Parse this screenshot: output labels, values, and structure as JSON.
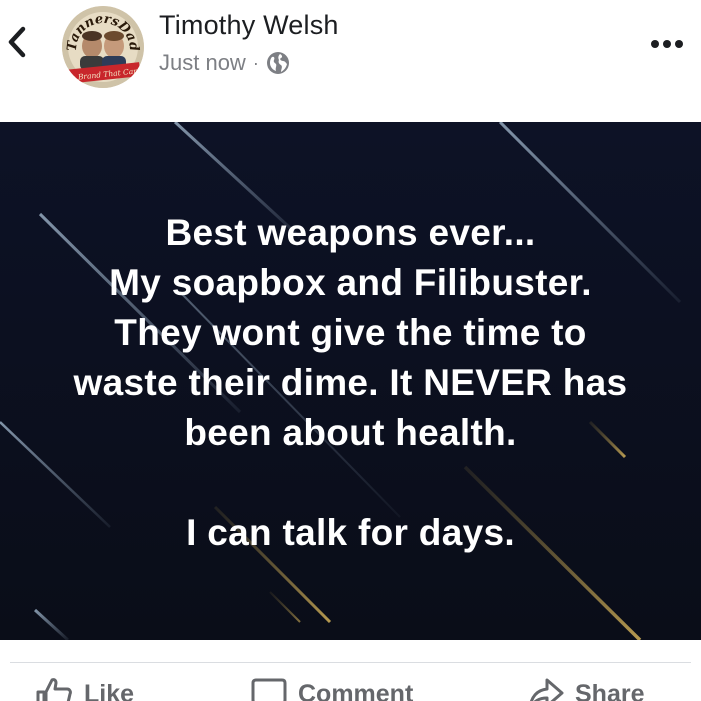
{
  "post": {
    "author": "Timothy Welsh",
    "timestamp": "Just now",
    "separator": "·",
    "privacy_icon": "globe-icon",
    "avatar": {
      "badge_top_text": "TannersDad",
      "badge_bottom_text": "The Brand That Cares",
      "badge_colors": {
        "banner": "#c8262b",
        "ring": "#e0a640",
        "text": "#2a1a0a"
      }
    },
    "image_text_lines": [
      "Best weapons ever...",
      "My soapbox and Filibuster.",
      "They wont give the time to",
      "waste their dime. It NEVER has",
      "been about health.",
      "",
      "I can talk for days."
    ]
  },
  "actions": {
    "like": {
      "label": "Like",
      "icon": "thumbs-up-icon"
    },
    "comment": {
      "label": "Comment",
      "icon": "comment-icon"
    },
    "share": {
      "label": "Share",
      "icon": "share-icon"
    }
  },
  "colors": {
    "image_background": "#0c1020",
    "image_text": "#ffffff",
    "secondary_text": "#65676b",
    "name_text": "#1c1e21"
  }
}
